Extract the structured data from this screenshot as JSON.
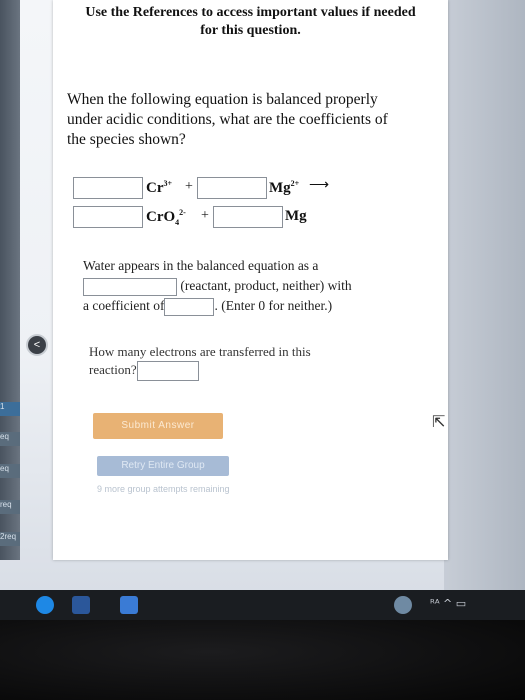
{
  "header": {
    "line1": "Use the References to access important values if needed",
    "line2": "for this question."
  },
  "question": {
    "text": "When the following equation is balanced properly under acidic conditions, what are the coefficients of the species shown?"
  },
  "equation": {
    "row1": {
      "species1": "Cr",
      "species1_charge": "3+",
      "plus": "+",
      "species2": "Mg",
      "species2_charge": "2+",
      "arrow": "⟶"
    },
    "row2": {
      "species1": "CrO",
      "species1_sub": "4",
      "species1_charge": "2-",
      "plus": "+",
      "species2": "Mg"
    }
  },
  "water": {
    "line1": "Water appears in the balanced equation as a",
    "choices_text": "(reactant, product, neither) with",
    "coef_label": "a coefficient of",
    "hint": ". (Enter 0 for neither.)"
  },
  "electrons": {
    "text1": "How many electrons are transferred in this",
    "text2": "reaction?"
  },
  "buttons": {
    "submit": "Submit Answer",
    "retry": "Retry Entire Group",
    "remaining": "9 more group attempts remaining"
  },
  "sidebar": {
    "tabs": [
      "1",
      "eq",
      "eq",
      "req",
      "2req"
    ]
  },
  "nav": {
    "back": "<"
  },
  "taskbar": {
    "colors": {
      "edge": "#1e88e5",
      "word": "#2b579a",
      "app": "#3a7bd5"
    },
    "tray": "ᴿᴬ ^ ▭"
  }
}
